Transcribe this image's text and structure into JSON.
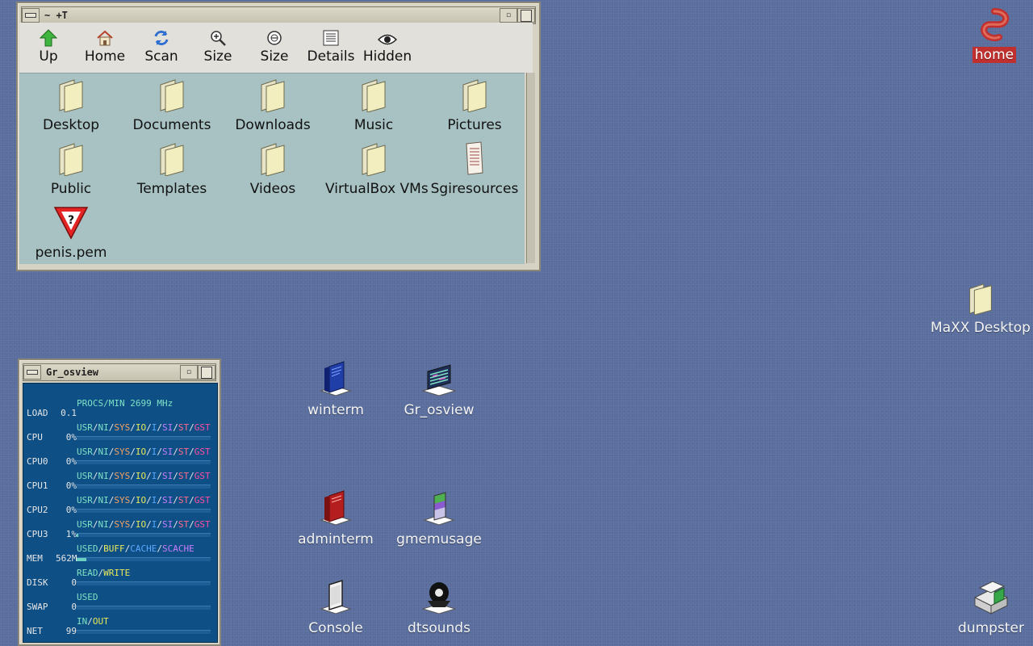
{
  "file_manager": {
    "title": "~ +T",
    "toolbar": [
      {
        "label": "Up",
        "icon": "up-arrow-icon"
      },
      {
        "label": "Home",
        "icon": "home-icon"
      },
      {
        "label": "Scan",
        "icon": "refresh-icon"
      },
      {
        "label": "Size",
        "icon": "zoom-in-icon"
      },
      {
        "label": "Size",
        "icon": "zoom-out-icon"
      },
      {
        "label": "Details",
        "icon": "details-icon"
      },
      {
        "label": "Hidden",
        "icon": "eye-icon"
      }
    ],
    "items": [
      {
        "label": "Desktop",
        "icon": "folder-icon"
      },
      {
        "label": "Documents",
        "icon": "folder-icon"
      },
      {
        "label": "Downloads",
        "icon": "folder-icon"
      },
      {
        "label": "Music",
        "icon": "folder-icon"
      },
      {
        "label": "Pictures",
        "icon": "folder-icon"
      },
      {
        "label": "Public",
        "icon": "folder-icon"
      },
      {
        "label": "Templates",
        "icon": "folder-icon"
      },
      {
        "label": "Videos",
        "icon": "folder-icon"
      },
      {
        "label": "VirtualBox VMs",
        "icon": "folder-icon"
      },
      {
        "label": "Sgiresources",
        "icon": "document-icon"
      },
      {
        "label": "penis.pem",
        "icon": "unknown-file-icon"
      }
    ]
  },
  "osview": {
    "title": "Gr_osview",
    "header": "PROCS/MIN  2699 MHz",
    "rows": [
      {
        "name": "LOAD",
        "value": "0.1",
        "legend": "PROCS/MIN  2699 MHz",
        "fill": 0
      },
      {
        "name": "CPU",
        "value": "0%",
        "legend": "cpu",
        "fill": 0
      },
      {
        "name": "CPU0",
        "value": "0%",
        "legend": "cpu",
        "fill": 0
      },
      {
        "name": "CPU1",
        "value": "0%",
        "legend": "cpu",
        "fill": 0
      },
      {
        "name": "CPU2",
        "value": "0%",
        "legend": "cpu",
        "fill": 0
      },
      {
        "name": "CPU3",
        "value": "1%",
        "legend": "cpu",
        "fill": 0.01
      },
      {
        "name": "MEM",
        "value": "562M",
        "legend": "mem",
        "fill": 0.07
      },
      {
        "name": "DISK",
        "value": "0",
        "legend": "disk",
        "fill": 0
      },
      {
        "name": "SWAP",
        "value": "0",
        "legend": "swap",
        "fill": 0
      },
      {
        "name": "NET",
        "value": "99",
        "legend": "net",
        "fill": 0
      }
    ],
    "cpu_legend": [
      "USR",
      "NI",
      "SYS",
      "IO",
      "I",
      "SI",
      "ST",
      "GST"
    ],
    "mem_legend": [
      "USED",
      "BUFF",
      "CACHE",
      "SCACHE"
    ],
    "disk_legend": [
      "READ",
      "WRITE"
    ],
    "swap_legend": [
      "USED"
    ],
    "net_legend": [
      "IN",
      "OUT"
    ]
  },
  "desktop_icons": [
    {
      "label": "home",
      "icon": "home-swirl-icon"
    },
    {
      "label": "MaXX Desktop",
      "icon": "folder-icon"
    },
    {
      "label": "winterm",
      "icon": "terminal-icon"
    },
    {
      "label": "Gr_osview",
      "icon": "monitor-graph-icon"
    },
    {
      "label": "adminterm",
      "icon": "admin-terminal-icon"
    },
    {
      "label": "gmemusage",
      "icon": "memory-chart-icon"
    },
    {
      "label": "Console",
      "icon": "console-icon"
    },
    {
      "label": "dtsounds",
      "icon": "speaker-icon"
    },
    {
      "label": "dumpster",
      "icon": "trash-icon"
    }
  ],
  "colors": {
    "desktop": "#5a6e9e",
    "fm_body": "#a8c2c4",
    "osview_bg": "#0e4f86",
    "home_highlight": "#c0302e"
  }
}
